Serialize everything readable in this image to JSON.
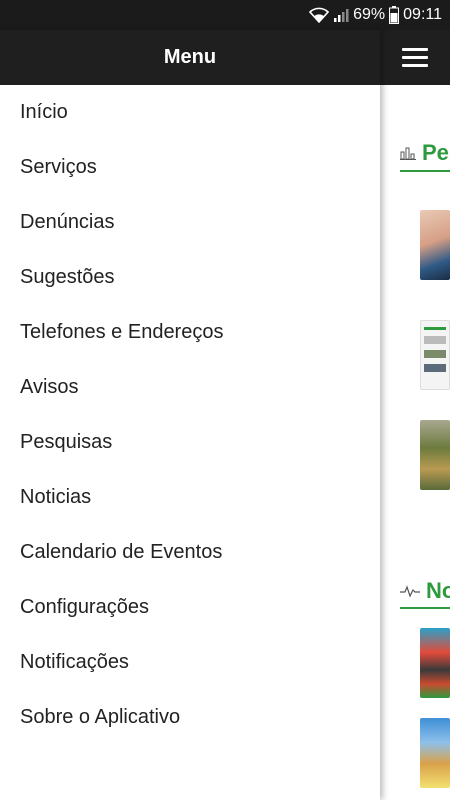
{
  "status_bar": {
    "battery_percent": "69%",
    "time": "09:11",
    "icons": [
      "wifi-icon",
      "signal-icon",
      "battery-icon"
    ]
  },
  "drawer": {
    "title": "Menu",
    "items": [
      {
        "label": "Início"
      },
      {
        "label": "Serviços"
      },
      {
        "label": "Denúncias"
      },
      {
        "label": "Sugestões"
      },
      {
        "label": "Telefones e Endereços"
      },
      {
        "label": "Avisos"
      },
      {
        "label": "Pesquisas"
      },
      {
        "label": "Noticias"
      },
      {
        "label": "Calendario de Eventos"
      },
      {
        "label": "Configurações"
      },
      {
        "label": "Notificações"
      },
      {
        "label": "Sobre o Aplicativo"
      }
    ]
  },
  "background": {
    "sections": [
      {
        "title_visible": "Pes",
        "icon": "bar-chart-icon"
      },
      {
        "title_visible": "No",
        "icon": "pulse-icon"
      }
    ]
  },
  "colors": {
    "app_bar": "#1f1f1f",
    "status_bar": "#1b1b1b",
    "accent_green": "#2e9a3e",
    "text": "#222222"
  }
}
